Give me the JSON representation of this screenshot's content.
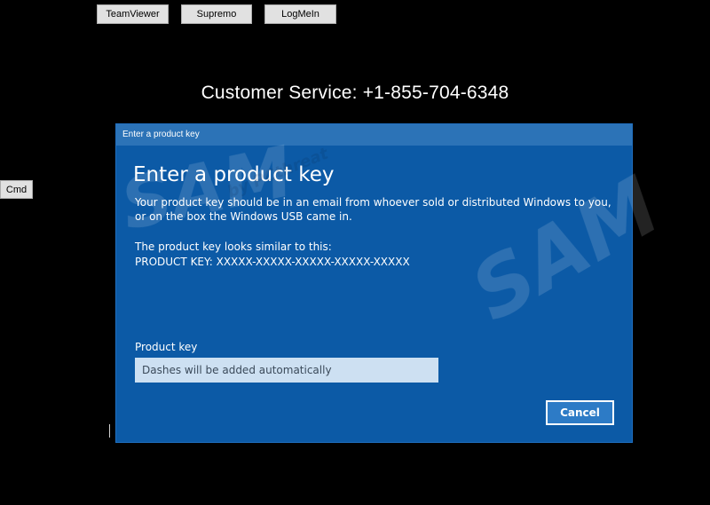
{
  "toolbar": {
    "teamviewer_label": "TeamViewer",
    "supremo_label": "Supremo",
    "logmein_label": "LogMeIn"
  },
  "side": {
    "cmd_label": "Cmd"
  },
  "banner": {
    "customer_service": "Customer Service: +1-855-704-6348"
  },
  "dialog": {
    "titlebar": "Enter a product key",
    "heading": "Enter a product key",
    "paragraph1": "Your product key should be in an email from whoever sold or distributed Windows to you, or on the box the Windows USB came in.",
    "paragraph2_line1": "The product key looks similar to this:",
    "paragraph2_line2": "PRODUCT KEY: XXXXX-XXXXX-XXXXX-XXXXX-XXXXX",
    "field_label": "Product key",
    "field_placeholder": "Dashes will be added automatically",
    "field_value": "",
    "cancel_label": "Cancel"
  },
  "colors": {
    "background": "#000000",
    "dialog_bg": "#0c5aa6",
    "titlebar_bg": "#2c73b7",
    "input_bg": "#cde0f2",
    "button_bg": "#2d7bc6"
  }
}
